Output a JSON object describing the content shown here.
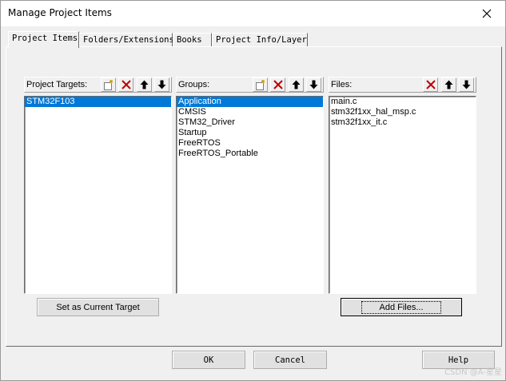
{
  "window": {
    "title": "Manage Project Items"
  },
  "tabs": [
    {
      "label": "Project Items"
    },
    {
      "label": "Folders/Extensions"
    },
    {
      "label": "Books"
    },
    {
      "label": "Project Info/Layer"
    }
  ],
  "project_targets": {
    "label": "Project Targets:",
    "items": [
      "STM32F103"
    ],
    "selected_index": 0
  },
  "groups": {
    "label": "Groups:",
    "items": [
      "Application",
      "CMSIS",
      "STM32_Driver",
      "Startup",
      "FreeRTOS",
      "FreeRTOS_Portable"
    ],
    "selected_index": 0
  },
  "files": {
    "label": "Files:",
    "items": [
      "main.c",
      "stm32f1xx_hal_msp.c",
      "stm32f1xx_it.c"
    ]
  },
  "buttons": {
    "set_target": "Set as Current Target",
    "add_files": "Add Files...",
    "ok": "OK",
    "cancel": "Cancel",
    "help": "Help"
  },
  "icons": {
    "new": "new-item-icon",
    "delete": "delete-icon",
    "up": "move-up-icon",
    "down": "move-down-icon",
    "close": "close-icon"
  },
  "colors": {
    "selection": "#0078d7",
    "delete_red": "#c00000"
  },
  "watermark": "CSDN @A-星星"
}
